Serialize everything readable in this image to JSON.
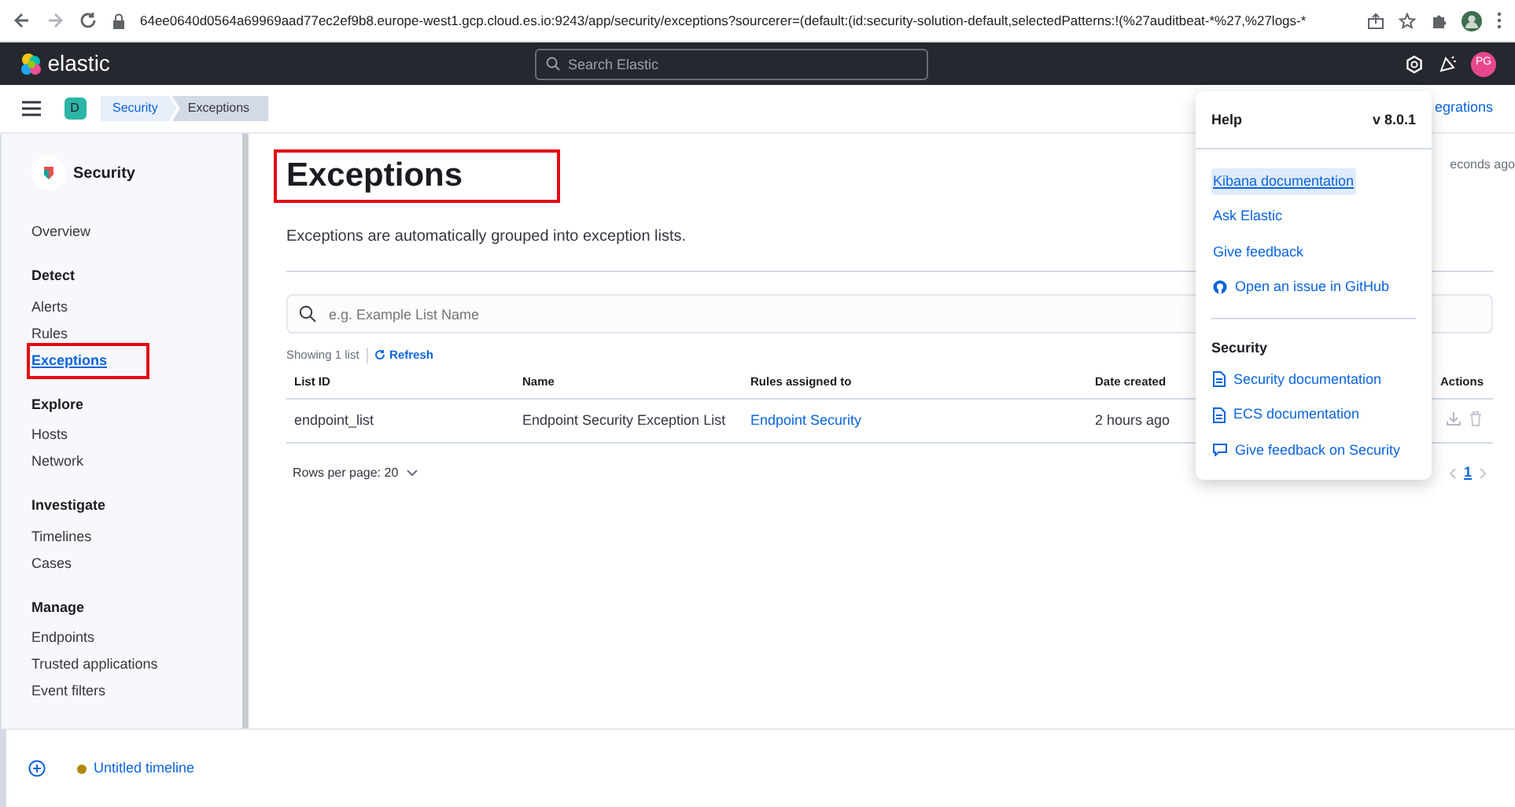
{
  "browser": {
    "url": "64ee0640d0564a69969aad77ec2ef9b8.europe-west1.gcp.cloud.es.io:9243/app/security/exceptions?sourcerer=(default:(id:security-solution-default,selectedPatterns:!(%27auditbeat-*%27,%27logs-*"
  },
  "header": {
    "brand": "elastic",
    "search": {
      "placeholder": "Search Elastic"
    },
    "avatar": "PG"
  },
  "breadcrumb_bar": {
    "space": "D",
    "crumbs": [
      "Security",
      "Exceptions"
    ],
    "right_link": "egrations"
  },
  "sidebar": {
    "title": "Security",
    "sections": [
      {
        "items": [
          {
            "label": "Overview",
            "selected": false
          }
        ]
      },
      {
        "heading": "Detect",
        "items": [
          {
            "label": "Alerts",
            "selected": false
          },
          {
            "label": "Rules",
            "selected": false
          },
          {
            "label": "Exceptions",
            "selected": true
          }
        ]
      },
      {
        "heading": "Explore",
        "items": [
          {
            "label": "Hosts",
            "selected": false
          },
          {
            "label": "Network",
            "selected": false
          }
        ]
      },
      {
        "heading": "Investigate",
        "items": [
          {
            "label": "Timelines",
            "selected": false
          },
          {
            "label": "Cases",
            "selected": false
          }
        ]
      },
      {
        "heading": "Manage",
        "items": [
          {
            "label": "Endpoints",
            "selected": false
          },
          {
            "label": "Trusted applications",
            "selected": false
          },
          {
            "label": "Event filters",
            "selected": false
          }
        ]
      }
    ]
  },
  "page": {
    "title": "Exceptions",
    "updated": "econds ago",
    "description": "Exceptions are automatically grouped into exception lists.",
    "search": {
      "placeholder": "e.g. Example List Name"
    },
    "showing": "Showing 1 list",
    "refresh": "Refresh",
    "table": {
      "columns": [
        "List ID",
        "Name",
        "Rules assigned to",
        "Date created",
        "Actions"
      ],
      "rows": [
        {
          "list_id": "endpoint_list",
          "name": "Endpoint Security Exception List",
          "rules": "Endpoint Security",
          "date": "2 hours ago"
        }
      ]
    },
    "rows_per_page": "Rows per page: 20",
    "pagination": {
      "pages": [
        {
          "label": "1",
          "selected": true
        }
      ]
    }
  },
  "help_popover": {
    "title": "Help",
    "version": "v 8.0.1",
    "links": [
      {
        "label": "Kibana documentation",
        "kind": "plain",
        "selected": true
      },
      {
        "label": "Ask Elastic",
        "kind": "plain",
        "selected": false
      },
      {
        "label": "Give feedback",
        "kind": "plain",
        "selected": false
      },
      {
        "label": "Open an issue in GitHub",
        "kind": "github",
        "selected": false
      }
    ],
    "section": "Security",
    "section_links": [
      {
        "label": "Security documentation",
        "kind": "doc"
      },
      {
        "label": "ECS documentation",
        "kind": "doc"
      },
      {
        "label": "Give feedback on Security",
        "kind": "chat"
      }
    ]
  },
  "timeline_bar": {
    "label": "Untitled timeline",
    "color": "#b0890a"
  }
}
